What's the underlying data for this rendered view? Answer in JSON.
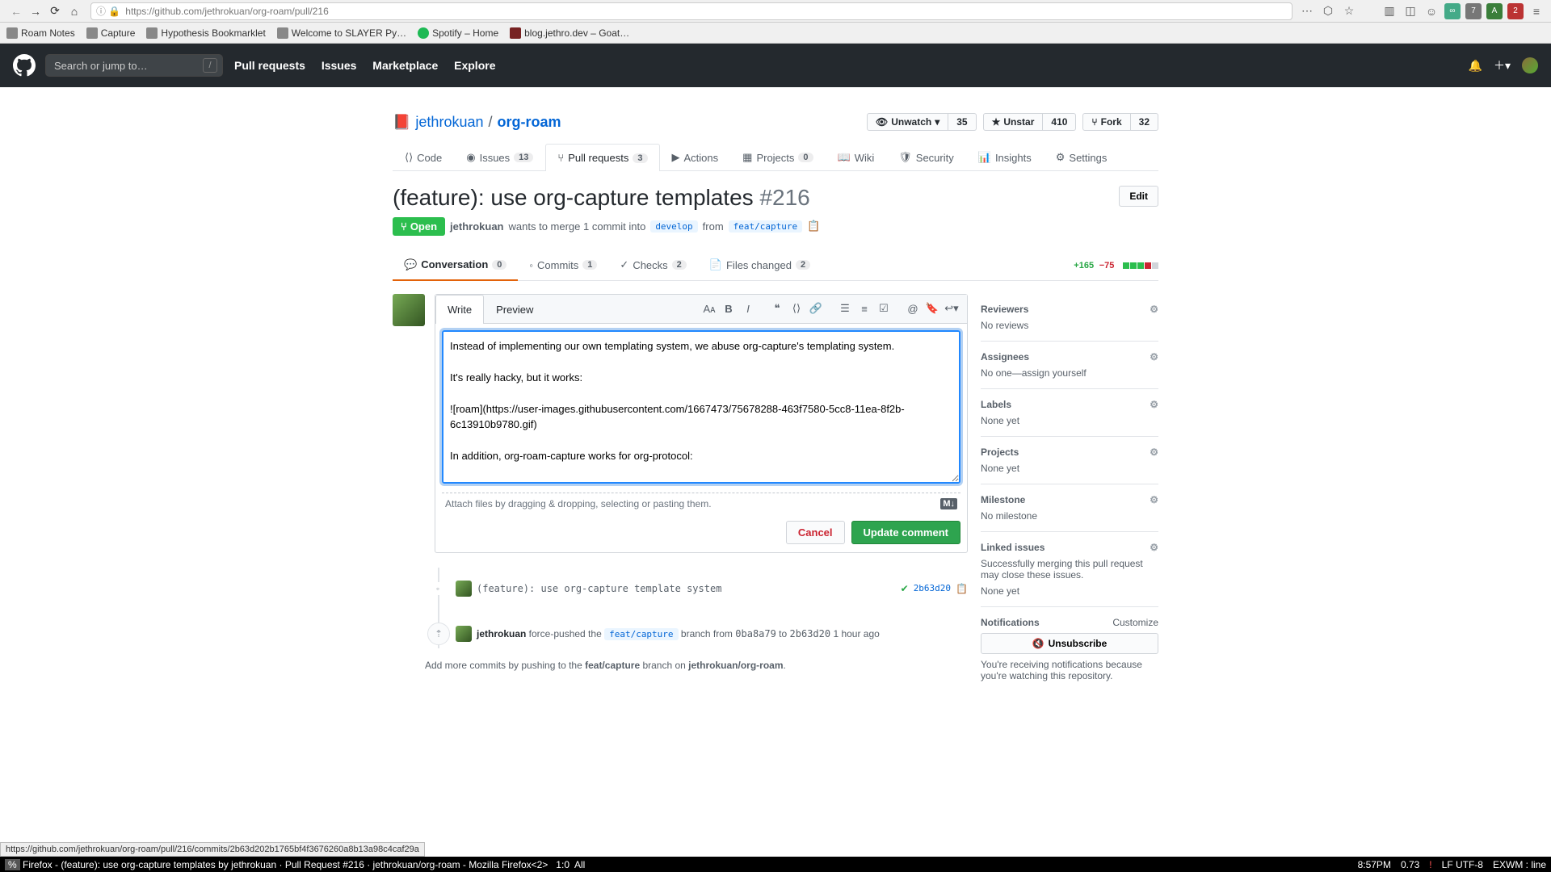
{
  "browser": {
    "url": "https://github.com/jethrokuan/org-roam/pull/216",
    "hover_url": "https://github.com/jethrokuan/org-roam/pull/216/commits/2b63d202b1765bf4f3676260a8b13a98c4caf29a"
  },
  "bookmarks": [
    {
      "label": "Roam Notes"
    },
    {
      "label": "Capture"
    },
    {
      "label": "Hypothesis Bookmarklet"
    },
    {
      "label": "Welcome to SLAYER Py…"
    },
    {
      "label": "Spotify – Home"
    },
    {
      "label": "blog.jethro.dev – Goat…"
    }
  ],
  "gh_header": {
    "search_placeholder": "Search or jump to…",
    "nav": [
      "Pull requests",
      "Issues",
      "Marketplace",
      "Explore"
    ]
  },
  "repo": {
    "owner": "jethrokuan",
    "name": "org-roam",
    "watch_label": "Unwatch",
    "watch_count": "35",
    "star_label": "Unstar",
    "star_count": "410",
    "fork_label": "Fork",
    "fork_count": "32"
  },
  "repo_nav": {
    "code": "Code",
    "issues": "Issues",
    "issues_count": "13",
    "pulls": "Pull requests",
    "pulls_count": "3",
    "actions": "Actions",
    "projects": "Projects",
    "projects_count": "0",
    "wiki": "Wiki",
    "security": "Security",
    "insights": "Insights",
    "settings": "Settings"
  },
  "pr": {
    "title": "(feature): use org-capture templates",
    "number": "#216",
    "edit": "Edit",
    "state": "Open",
    "author": "jethrokuan",
    "merge_text_1": " wants to merge 1 commit into ",
    "base_branch": "develop",
    "from_text": " from ",
    "head_branch": "feat/capture"
  },
  "pr_tabs": {
    "conversation": "Conversation",
    "conversation_count": "0",
    "commits": "Commits",
    "commits_count": "1",
    "checks": "Checks",
    "checks_count": "2",
    "files": "Files changed",
    "files_count": "2",
    "additions": "+165",
    "deletions": "−75"
  },
  "comment": {
    "write": "Write",
    "preview": "Preview",
    "body": "Instead of implementing our own templating system, we abuse org-capture's templating system.\n\nIt's really hacky, but it works:\n\n![roam](https://user-images.githubusercontent.com/1667473/75678288-463f7580-5cc8-11ea-8f2b-6c13910b9780.gif)\n\nIn addition, org-roam-capture works for org-protocol:\n\n\n###### Motivation for this change",
    "attach_hint": "Attach files by dragging & dropping, selecting or pasting them.",
    "cancel": "Cancel",
    "submit": "Update comment"
  },
  "timeline": {
    "commit": {
      "message": "(feature): use org-capture template system",
      "hash": "2b63d20"
    },
    "push": {
      "author": "jethrokuan",
      "text1": " force-pushed the ",
      "branch": "feat/capture",
      "text2": " branch from ",
      "from_sha": "0ba8a79",
      "to_word": " to ",
      "to_sha": "2b63d20",
      "time": " 1 hour ago"
    },
    "hint_pre": "Add more commits by pushing to the ",
    "hint_branch": "feat/capture",
    "hint_mid": " branch on ",
    "hint_repo": "jethrokuan/org-roam",
    "hint_dot": "."
  },
  "sidebar": {
    "reviewers": {
      "title": "Reviewers",
      "body": "No reviews"
    },
    "assignees": {
      "title": "Assignees",
      "body_pre": "No one—",
      "assign_self": "assign yourself"
    },
    "labels": {
      "title": "Labels",
      "body": "None yet"
    },
    "projects": {
      "title": "Projects",
      "body": "None yet"
    },
    "milestone": {
      "title": "Milestone",
      "body": "No milestone"
    },
    "linked": {
      "title": "Linked issues",
      "desc": "Successfully merging this pull request may close these issues.",
      "body": "None yet"
    },
    "notifications": {
      "title": "Notifications",
      "customize": "Customize",
      "button": "Unsubscribe",
      "desc": "You're receiving notifications because you're watching this repository."
    }
  },
  "statusbar": {
    "left_pct": "%",
    "title": " Firefox - (feature): use org-capture templates by jethrokuan · Pull Request #216 · jethrokuan/org-roam - Mozilla Firefox<2>   1:0  All",
    "time": "8:57PM",
    "load": "0.73",
    "warn": "!",
    "enc": "LF UTF-8",
    "wm": "EXWM : line"
  }
}
